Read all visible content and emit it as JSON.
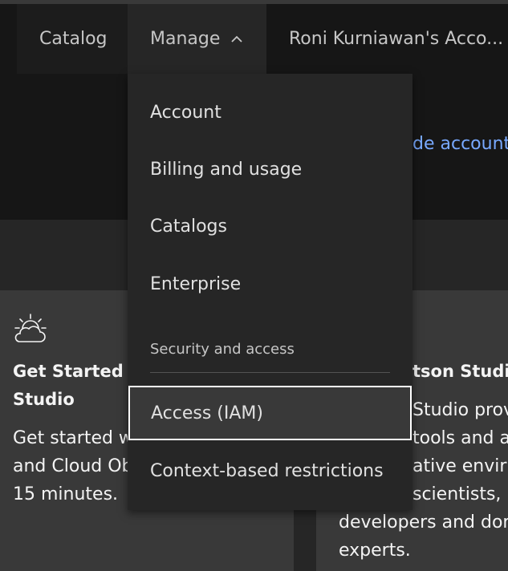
{
  "header": {
    "catalog_label": "Catalog",
    "manage_label": "Manage",
    "account_label": "Roni Kurniawan's Acco..."
  },
  "hero": {
    "link_text": "de account"
  },
  "menu": {
    "items": [
      "Account",
      "Billing and usage",
      "Catalogs",
      "Enterprise"
    ],
    "section_heading": "Security and access",
    "section_items": [
      "Access (IAM)",
      "Context-based restrictions"
    ],
    "selected_item": "Access (IAM)"
  },
  "cards": [
    {
      "icon": "cloud-sun-icon",
      "title_lines": [
        "Get Started w",
        "Studio"
      ],
      "body_lines": [
        "Get started w",
        "and Cloud Ob",
        "15 minutes."
      ]
    },
    {
      "title_lines": [
        "tson Studio"
      ],
      "body_lines": [
        "Studio prov",
        "tools and a",
        "ative envir",
        "scientists,",
        "developers and dor",
        "experts."
      ]
    }
  ],
  "colors": {
    "link": "#78a9ff",
    "header_bg": "#161616",
    "menu_bg": "#262626",
    "card_bg": "#393939",
    "focus_border": "#ffffff"
  }
}
